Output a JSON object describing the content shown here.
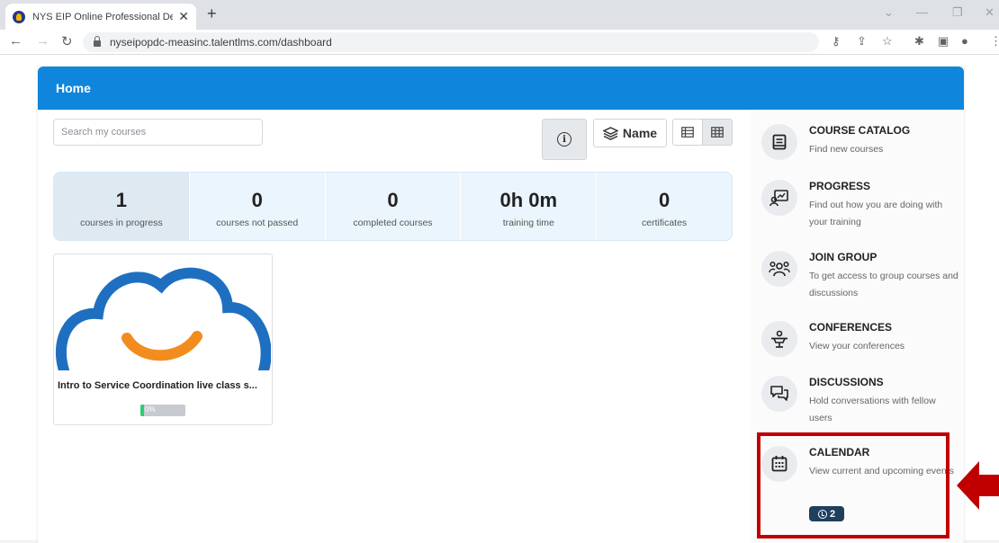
{
  "browser": {
    "tab_title": "NYS EIP Online Professional Deve",
    "tab_close": "✕",
    "new_tab": "+",
    "url": "nyseipopdc-measinc.talentlms.com/dashboard"
  },
  "header": {
    "title": "Home"
  },
  "search": {
    "placeholder": "Search my courses"
  },
  "toolbar": {
    "info_label": "i",
    "sort_label": "Name"
  },
  "stats": [
    {
      "value": "1",
      "label": "courses in progress"
    },
    {
      "value": "0",
      "label": "courses not passed"
    },
    {
      "value": "0",
      "label": "completed courses"
    },
    {
      "value": "0h 0m",
      "label": "training time"
    },
    {
      "value": "0",
      "label": "certificates"
    }
  ],
  "course": {
    "title": "Intro to Service Coordination live class s...",
    "progress_label": "0%",
    "progress": 0
  },
  "sidebar": {
    "items": [
      {
        "title": "COURSE CATALOG",
        "desc": "Find new courses",
        "icon": "book-icon"
      },
      {
        "title": "PROGRESS",
        "desc": "Find out how you are doing with your training",
        "icon": "progress-icon"
      },
      {
        "title": "JOIN GROUP",
        "desc": "To get access to group courses and discussions",
        "icon": "group-icon"
      },
      {
        "title": "CONFERENCES",
        "desc": "View your conferences",
        "icon": "conference-icon"
      },
      {
        "title": "DISCUSSIONS",
        "desc": "Hold conversations with fellow users",
        "icon": "chat-icon"
      },
      {
        "title": "CALENDAR",
        "desc": "View current and upcoming events",
        "icon": "calendar-icon",
        "badge": "2"
      }
    ]
  },
  "colors": {
    "header": "#0f86dc",
    "highlight": "#c00000",
    "arrow": "#c00000",
    "badge": "#1f3f5e"
  }
}
